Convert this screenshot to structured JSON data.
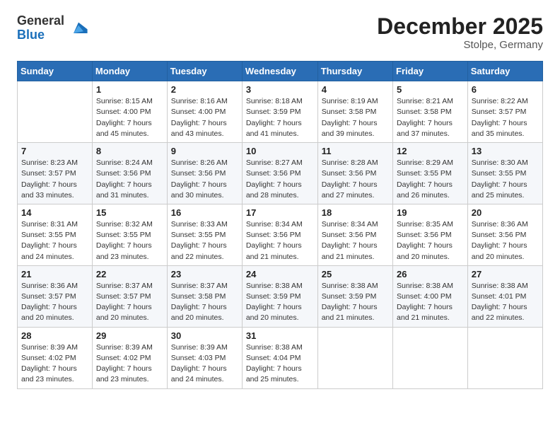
{
  "header": {
    "logo_general": "General",
    "logo_blue": "Blue",
    "month_title": "December 2025",
    "location": "Stolpe, Germany"
  },
  "weekdays": [
    "Sunday",
    "Monday",
    "Tuesday",
    "Wednesday",
    "Thursday",
    "Friday",
    "Saturday"
  ],
  "weeks": [
    [
      {
        "day": "",
        "sunrise": "",
        "sunset": "",
        "daylight": ""
      },
      {
        "day": "1",
        "sunrise": "Sunrise: 8:15 AM",
        "sunset": "Sunset: 4:00 PM",
        "daylight": "Daylight: 7 hours and 45 minutes."
      },
      {
        "day": "2",
        "sunrise": "Sunrise: 8:16 AM",
        "sunset": "Sunset: 4:00 PM",
        "daylight": "Daylight: 7 hours and 43 minutes."
      },
      {
        "day": "3",
        "sunrise": "Sunrise: 8:18 AM",
        "sunset": "Sunset: 3:59 PM",
        "daylight": "Daylight: 7 hours and 41 minutes."
      },
      {
        "day": "4",
        "sunrise": "Sunrise: 8:19 AM",
        "sunset": "Sunset: 3:58 PM",
        "daylight": "Daylight: 7 hours and 39 minutes."
      },
      {
        "day": "5",
        "sunrise": "Sunrise: 8:21 AM",
        "sunset": "Sunset: 3:58 PM",
        "daylight": "Daylight: 7 hours and 37 minutes."
      },
      {
        "day": "6",
        "sunrise": "Sunrise: 8:22 AM",
        "sunset": "Sunset: 3:57 PM",
        "daylight": "Daylight: 7 hours and 35 minutes."
      }
    ],
    [
      {
        "day": "7",
        "sunrise": "Sunrise: 8:23 AM",
        "sunset": "Sunset: 3:57 PM",
        "daylight": "Daylight: 7 hours and 33 minutes."
      },
      {
        "day": "8",
        "sunrise": "Sunrise: 8:24 AM",
        "sunset": "Sunset: 3:56 PM",
        "daylight": "Daylight: 7 hours and 31 minutes."
      },
      {
        "day": "9",
        "sunrise": "Sunrise: 8:26 AM",
        "sunset": "Sunset: 3:56 PM",
        "daylight": "Daylight: 7 hours and 30 minutes."
      },
      {
        "day": "10",
        "sunrise": "Sunrise: 8:27 AM",
        "sunset": "Sunset: 3:56 PM",
        "daylight": "Daylight: 7 hours and 28 minutes."
      },
      {
        "day": "11",
        "sunrise": "Sunrise: 8:28 AM",
        "sunset": "Sunset: 3:56 PM",
        "daylight": "Daylight: 7 hours and 27 minutes."
      },
      {
        "day": "12",
        "sunrise": "Sunrise: 8:29 AM",
        "sunset": "Sunset: 3:55 PM",
        "daylight": "Daylight: 7 hours and 26 minutes."
      },
      {
        "day": "13",
        "sunrise": "Sunrise: 8:30 AM",
        "sunset": "Sunset: 3:55 PM",
        "daylight": "Daylight: 7 hours and 25 minutes."
      }
    ],
    [
      {
        "day": "14",
        "sunrise": "Sunrise: 8:31 AM",
        "sunset": "Sunset: 3:55 PM",
        "daylight": "Daylight: 7 hours and 24 minutes."
      },
      {
        "day": "15",
        "sunrise": "Sunrise: 8:32 AM",
        "sunset": "Sunset: 3:55 PM",
        "daylight": "Daylight: 7 hours and 23 minutes."
      },
      {
        "day": "16",
        "sunrise": "Sunrise: 8:33 AM",
        "sunset": "Sunset: 3:55 PM",
        "daylight": "Daylight: 7 hours and 22 minutes."
      },
      {
        "day": "17",
        "sunrise": "Sunrise: 8:34 AM",
        "sunset": "Sunset: 3:56 PM",
        "daylight": "Daylight: 7 hours and 21 minutes."
      },
      {
        "day": "18",
        "sunrise": "Sunrise: 8:34 AM",
        "sunset": "Sunset: 3:56 PM",
        "daylight": "Daylight: 7 hours and 21 minutes."
      },
      {
        "day": "19",
        "sunrise": "Sunrise: 8:35 AM",
        "sunset": "Sunset: 3:56 PM",
        "daylight": "Daylight: 7 hours and 20 minutes."
      },
      {
        "day": "20",
        "sunrise": "Sunrise: 8:36 AM",
        "sunset": "Sunset: 3:56 PM",
        "daylight": "Daylight: 7 hours and 20 minutes."
      }
    ],
    [
      {
        "day": "21",
        "sunrise": "Sunrise: 8:36 AM",
        "sunset": "Sunset: 3:57 PM",
        "daylight": "Daylight: 7 hours and 20 minutes."
      },
      {
        "day": "22",
        "sunrise": "Sunrise: 8:37 AM",
        "sunset": "Sunset: 3:57 PM",
        "daylight": "Daylight: 7 hours and 20 minutes."
      },
      {
        "day": "23",
        "sunrise": "Sunrise: 8:37 AM",
        "sunset": "Sunset: 3:58 PM",
        "daylight": "Daylight: 7 hours and 20 minutes."
      },
      {
        "day": "24",
        "sunrise": "Sunrise: 8:38 AM",
        "sunset": "Sunset: 3:59 PM",
        "daylight": "Daylight: 7 hours and 20 minutes."
      },
      {
        "day": "25",
        "sunrise": "Sunrise: 8:38 AM",
        "sunset": "Sunset: 3:59 PM",
        "daylight": "Daylight: 7 hours and 21 minutes."
      },
      {
        "day": "26",
        "sunrise": "Sunrise: 8:38 AM",
        "sunset": "Sunset: 4:00 PM",
        "daylight": "Daylight: 7 hours and 21 minutes."
      },
      {
        "day": "27",
        "sunrise": "Sunrise: 8:38 AM",
        "sunset": "Sunset: 4:01 PM",
        "daylight": "Daylight: 7 hours and 22 minutes."
      }
    ],
    [
      {
        "day": "28",
        "sunrise": "Sunrise: 8:39 AM",
        "sunset": "Sunset: 4:02 PM",
        "daylight": "Daylight: 7 hours and 23 minutes."
      },
      {
        "day": "29",
        "sunrise": "Sunrise: 8:39 AM",
        "sunset": "Sunset: 4:02 PM",
        "daylight": "Daylight: 7 hours and 23 minutes."
      },
      {
        "day": "30",
        "sunrise": "Sunrise: 8:39 AM",
        "sunset": "Sunset: 4:03 PM",
        "daylight": "Daylight: 7 hours and 24 minutes."
      },
      {
        "day": "31",
        "sunrise": "Sunrise: 8:38 AM",
        "sunset": "Sunset: 4:04 PM",
        "daylight": "Daylight: 7 hours and 25 minutes."
      },
      {
        "day": "",
        "sunrise": "",
        "sunset": "",
        "daylight": ""
      },
      {
        "day": "",
        "sunrise": "",
        "sunset": "",
        "daylight": ""
      },
      {
        "day": "",
        "sunrise": "",
        "sunset": "",
        "daylight": ""
      }
    ]
  ]
}
